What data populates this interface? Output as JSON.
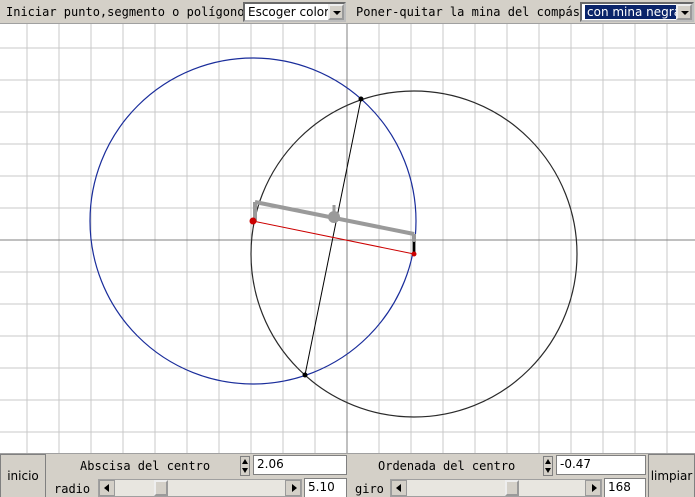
{
  "toolbar": {
    "start_label": "Iniciar punto,segmento o polígono",
    "color_select": {
      "value": "Escoger color"
    },
    "compass_label": "Poner-quitar la mina del compás",
    "compass_select": {
      "value": "con mina negra"
    }
  },
  "controls": {
    "inicio_label": "inicio",
    "limpiar_label": "limpiar",
    "abscisa": {
      "label": "Abscisa del centro",
      "value": "2.06"
    },
    "ordenada": {
      "label": "Ordenada del centro",
      "value": "-0.47"
    },
    "radio": {
      "label": "radio",
      "value": "5.10",
      "fraction": 0.25
    },
    "giro": {
      "label": "giro",
      "value": "168",
      "fraction": 0.6
    }
  },
  "colors": {
    "grid": "#c8c8c8",
    "axis": "#808080",
    "blue_circle": "#1a2d9b",
    "black_circle": "#2a2a2a",
    "red_segment": "#cc0000",
    "compass": "#9a9a9a"
  }
}
